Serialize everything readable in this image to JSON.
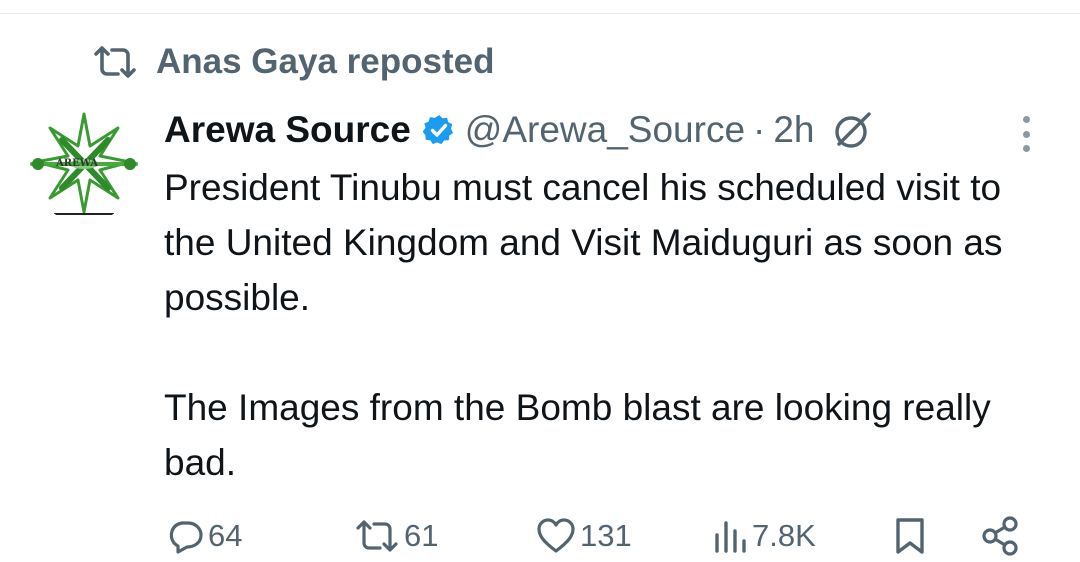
{
  "repost": {
    "text": "Anas Gaya reposted",
    "icon": "repost-icon"
  },
  "tweet": {
    "author": "Arewa Source",
    "verified": true,
    "handle": "@Arewa_Source",
    "separator": "·",
    "time": "2h",
    "avatar_text": "AREWA",
    "paragraphs": [
      "President Tinubu must cancel his scheduled visit to the United Kingdom and Visit Maiduguri as soon as possible.",
      "The Images from the Bomb blast are looking really bad."
    ]
  },
  "actions": {
    "replies": "64",
    "reposts": "61",
    "likes": "131",
    "views": "7.8K"
  },
  "colors": {
    "text": "#0f1419",
    "secondary": "#536471",
    "verified": "#1d9bf0",
    "logo_green": "#3a9a32"
  }
}
